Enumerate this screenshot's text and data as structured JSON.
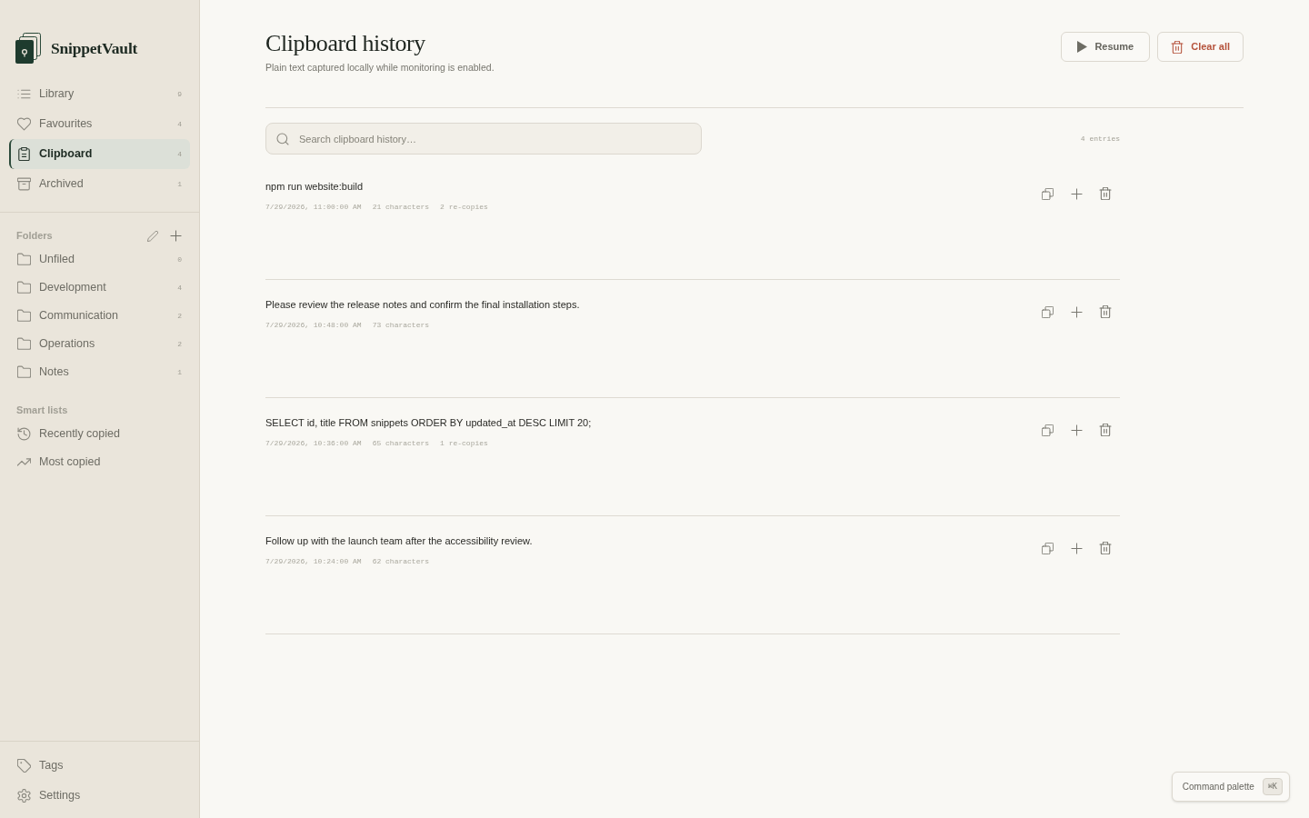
{
  "app": {
    "name": "SnippetVault"
  },
  "sidebar": {
    "nav": [
      {
        "label": "Library",
        "count": "9",
        "selected": false
      },
      {
        "label": "Favourites",
        "count": "4",
        "selected": false
      },
      {
        "label": "Clipboard",
        "count": "4",
        "selected": true
      },
      {
        "label": "Archived",
        "count": "1",
        "selected": false
      }
    ],
    "folders": {
      "title": "Folders",
      "items": [
        {
          "label": "Unfiled",
          "count": "0",
          "selected": false
        },
        {
          "label": "Development",
          "count": "4",
          "selected": false
        },
        {
          "label": "Communication",
          "count": "2",
          "selected": false
        },
        {
          "label": "Operations",
          "count": "2",
          "selected": false
        },
        {
          "label": "Notes",
          "count": "1",
          "selected": false
        }
      ]
    },
    "smart_lists": {
      "title": "Smart lists",
      "items": [
        {
          "label": "Recently copied",
          "selected": false
        },
        {
          "label": "Most copied",
          "selected": false
        }
      ]
    },
    "footer": [
      {
        "label": "Tags",
        "selected": false
      },
      {
        "label": "Settings",
        "selected": false
      }
    ]
  },
  "header": {
    "title": "Clipboard history",
    "subtitle": "Plain text captured locally while monitoring is enabled.",
    "buttons": [
      {
        "label": "Resume",
        "kind": "resume"
      },
      {
        "label": "Clear all",
        "kind": "danger"
      }
    ]
  },
  "search": {
    "placeholder": "Search clipboard history…"
  },
  "entry_count": "4 entries",
  "entries": [
    {
      "text": "npm run website:build",
      "copied_at": "7/29/2026, 11:00:00 AM",
      "characters": "21 characters",
      "recopies": "2 re-copies"
    },
    {
      "text": "Please review the release notes and confirm the final installation steps.",
      "copied_at": "7/29/2026, 10:48:00 AM",
      "characters": "73 characters"
    },
    {
      "text": "SELECT id, title FROM snippets ORDER BY updated_at DESC LIMIT 20;",
      "copied_at": "7/29/2026, 10:36:00 AM",
      "characters": "65 characters",
      "recopies": "1 re-copies"
    },
    {
      "text": "Follow up with the launch team after the accessibility review.",
      "copied_at": "7/29/2026, 10:24:00 AM",
      "characters": "62 characters"
    }
  ],
  "command_palette": {
    "label": "Command palette",
    "shortcut": "⌘K"
  }
}
